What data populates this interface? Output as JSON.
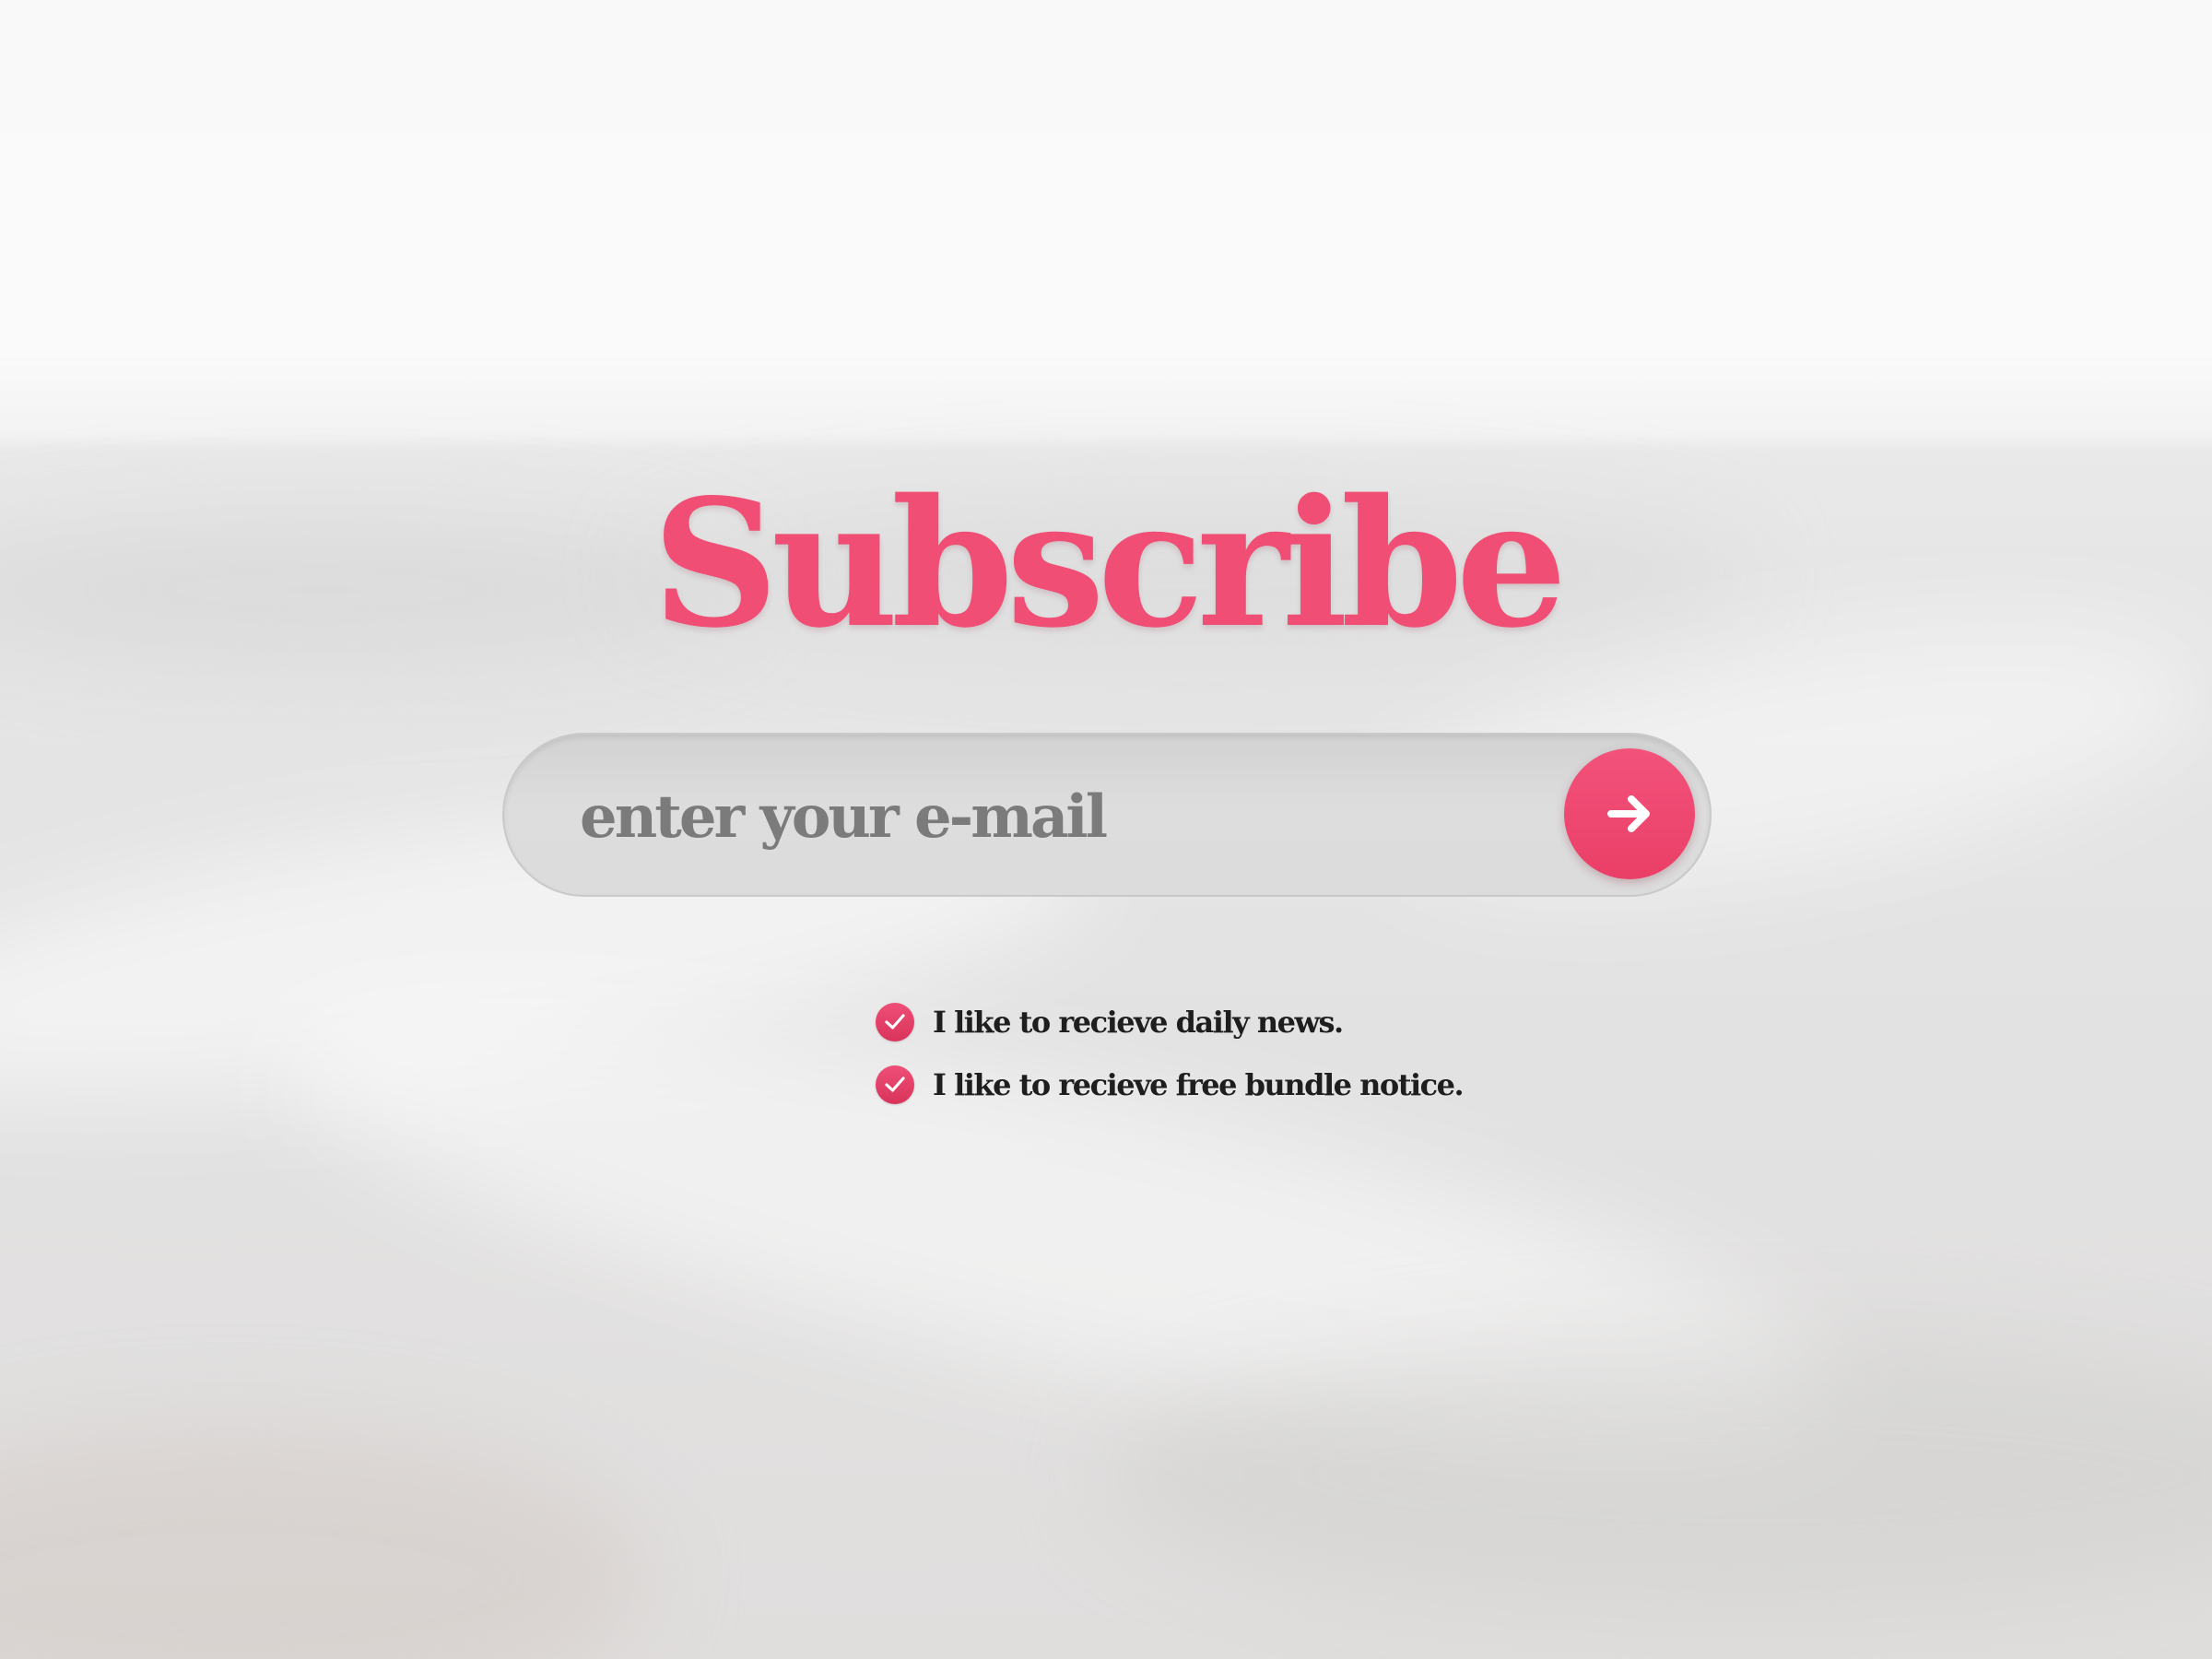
{
  "page": {
    "title": "Subscribe"
  },
  "form": {
    "email_placeholder": "enter your e-mail",
    "email_value": "",
    "submit_icon": "arrow-right-icon"
  },
  "options": [
    {
      "label": "I like to recieve daily news.",
      "checked": true,
      "icon": "check-icon"
    },
    {
      "label": "I like to recieve free bundle notice.",
      "checked": true,
      "icon": "check-icon"
    }
  ],
  "colors": {
    "accent": "#f04e74",
    "accent_dark": "#ea3f67",
    "input_bg": "#dddddd",
    "placeholder_text": "#7b7b7b",
    "label_text": "#1e1e1e"
  }
}
